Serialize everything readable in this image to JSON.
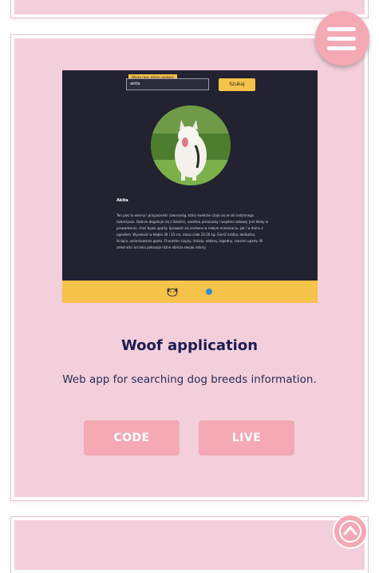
{
  "colors": {
    "card_bg": "#f2cfdb",
    "accent": "#f4a9b5",
    "title": "#1d1d52",
    "preview_bg": "#222231",
    "preview_accent": "#f5c24a"
  },
  "menu": {
    "icon": "hamburger-icon"
  },
  "scroll_top": {
    "icon": "chevron-up-icon"
  },
  "project": {
    "title": "Woof application",
    "description": "Web app for searching dog breeds information.",
    "code_label": "CODE",
    "live_label": "LIVE",
    "preview": {
      "hint": "Wpisz rasę, której szukasz",
      "input_value": "akita",
      "search_label": "Szukaj",
      "breed_name": "Akita",
      "breed_text": "Ten pies to wierny i przyjacielski czworonóg, który świetnie czuje się w roli rodzinnego towarzysza. Dobrze dogaduje się z dziećmi, uwielbia pieszczoty i wspólne zabawy. Jest łatwy w prowadzeniu, choć bywa uparty. Sprawdzi się zarówno w małym mieszkaniu, jak i w domu z ogrodem. Wysokość w kłębie 30 i 35 cm, masa ciała 22-26 kg. Sierść krótka, delikatna, lśniąca, umiarkowanie gęsta. Charakter czujny, śmiały, oddany, łagodny, czasem uparty. W zależności od dnia pokazuje różne oblicza swojej natury."
    }
  }
}
